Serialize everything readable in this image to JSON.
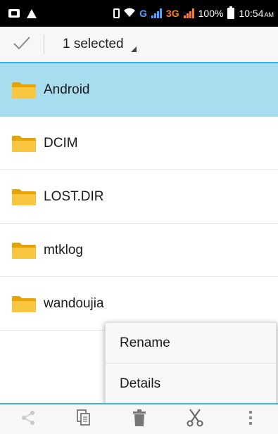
{
  "status_bar": {
    "network_g": "G",
    "network_3g": "3G",
    "battery_percent": "100%",
    "time": "10:54",
    "ampm": "AM"
  },
  "action_bar": {
    "done_icon": "checkmark-icon",
    "selection_label": "1 selected"
  },
  "files": [
    {
      "name": "Android",
      "selected": true,
      "icon": "folder-icon"
    },
    {
      "name": "DCIM",
      "selected": false,
      "icon": "folder-icon"
    },
    {
      "name": "LOST.DIR",
      "selected": false,
      "icon": "folder-icon"
    },
    {
      "name": "mtklog",
      "selected": false,
      "icon": "folder-icon"
    },
    {
      "name": "wandoujia",
      "selected": false,
      "icon": "folder-icon"
    }
  ],
  "popup_menu": {
    "items": [
      {
        "label": "Rename"
      },
      {
        "label": "Details"
      }
    ]
  },
  "bottom_bar": {
    "actions": [
      "share-icon",
      "copy-icon",
      "delete-icon",
      "cut-icon",
      "overflow-menu-icon"
    ]
  },
  "colors": {
    "accent": "#33b5e5",
    "selected_row": "#a8dcef",
    "folder": "#f7b500"
  }
}
